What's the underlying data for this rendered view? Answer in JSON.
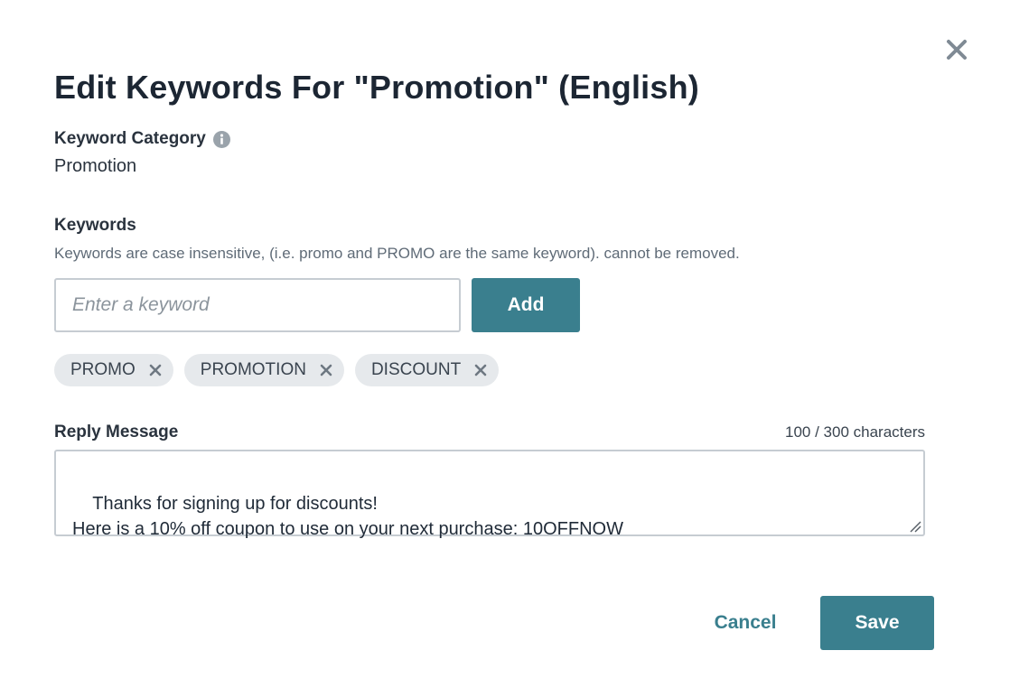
{
  "dialog": {
    "title": "Edit Keywords For \"Promotion\" (English)",
    "close_icon": "close-icon"
  },
  "category": {
    "label": "Keyword Category",
    "info_icon": "info-icon",
    "value": "Promotion"
  },
  "keywords": {
    "label": "Keywords",
    "help_text": "Keywords are case insensitive, (i.e. promo and PROMO are the same keyword). cannot be removed.",
    "input_value": "",
    "input_placeholder": "Enter a keyword",
    "add_label": "Add",
    "chips": [
      {
        "label": "PROMO"
      },
      {
        "label": "PROMOTION"
      },
      {
        "label": "DISCOUNT"
      }
    ]
  },
  "reply": {
    "label": "Reply Message",
    "char_count": "100 / 300 characters",
    "message": "Thanks for signing up for discounts!\nHere is a 10% off coupon to use on your next purchase: 10OFFNOW"
  },
  "footer": {
    "cancel_label": "Cancel",
    "save_label": "Save"
  },
  "colors": {
    "accent": "#3a7f8e",
    "chip_bg": "#e6e9ec",
    "border": "#c6ccd2",
    "title": "#1c2633"
  }
}
